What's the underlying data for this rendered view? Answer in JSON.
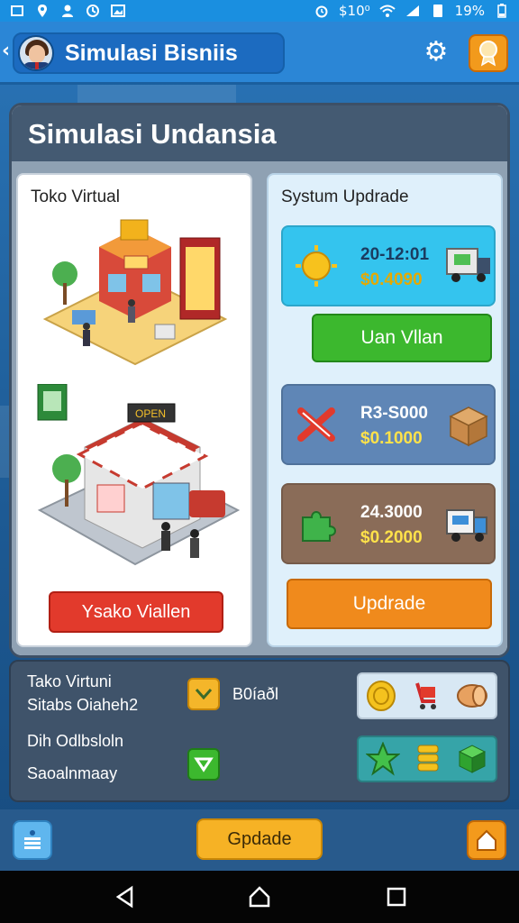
{
  "status_bar": {
    "left_icons": [
      "screen-icon",
      "location-pin-icon",
      "person-icon",
      "sync-icon",
      "image-icon"
    ],
    "right_text": "$10⁰",
    "battery": "19%"
  },
  "header": {
    "title": "Simulasi Bisniis"
  },
  "main": {
    "title": "Simulasi Undansia",
    "left_card": {
      "title": "Toko Virtual",
      "button_label": "Ysako Viallen"
    },
    "right_card": {
      "title": "Systum Updrade",
      "items": [
        {
          "line1": "20-12:01",
          "line2": "$0.4090"
        },
        {
          "line1": "R3-S000",
          "line2": "$0.1000"
        },
        {
          "line1": "24.3000",
          "line2": "$0.2000"
        }
      ],
      "green_button_label": "Uan Vllan",
      "orange_button_label": "Updrade"
    }
  },
  "bottom_panel": {
    "line1": "Tako Virtuni",
    "line2": "Sitabs Oiaheh2",
    "badge_text": "B0íaðl",
    "line3": "Dih Odlbsloln",
    "line4": "Saoalnmaay"
  },
  "bottom_bar": {
    "upgrade_label": "Gpdade"
  },
  "colors": {
    "accent_blue": "#2b86d6",
    "red_button": "#e23a2c",
    "green_button": "#3cb82e",
    "orange_button": "#f08a1c"
  }
}
